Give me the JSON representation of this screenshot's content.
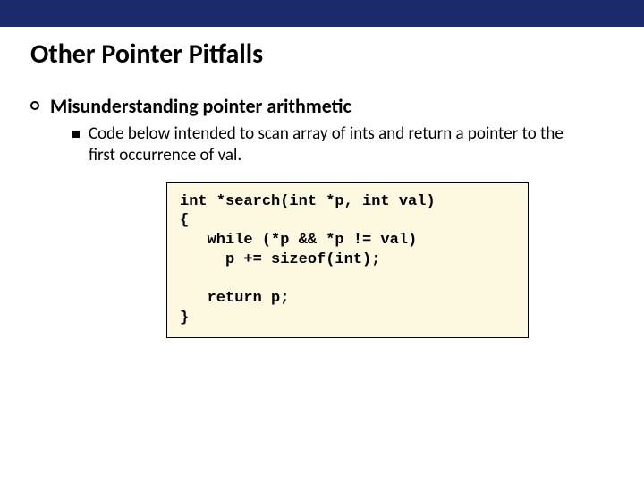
{
  "slide": {
    "title": "Other Pointer Pitfalls",
    "main_point": "Misunderstanding pointer arithmetic",
    "sub_point": "Code below intended to scan array of ints and return a pointer to the first occurrence of val.",
    "code": "int *search(int *p, int val)\n{\n   while (*p && *p != val)\n     p += sizeof(int);\n\n   return p;\n}"
  }
}
